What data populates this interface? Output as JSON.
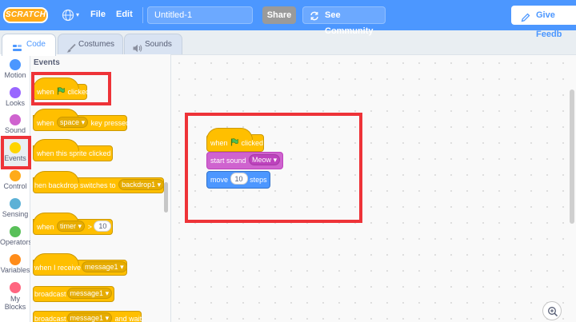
{
  "menubar": {
    "logo_text": "SCRATCH",
    "file": "File",
    "edit": "Edit",
    "project_title": "Untitled-1",
    "share": "Share",
    "see_community": "See Community",
    "give_feedback": "Give Feedb",
    "bg_color": "#4c97ff"
  },
  "tabs": {
    "code": "Code",
    "costumes": "Costumes",
    "sounds": "Sounds"
  },
  "categories": [
    {
      "label": "Motion",
      "color": "#4c97ff"
    },
    {
      "label": "Looks",
      "color": "#9966ff"
    },
    {
      "label": "Sound",
      "color": "#cf63cf"
    },
    {
      "label": "Events",
      "color": "#ffd500"
    },
    {
      "label": "Control",
      "color": "#ffab19"
    },
    {
      "label": "Sensing",
      "color": "#5cb1d6"
    },
    {
      "label": "Operators",
      "color": "#59c059"
    },
    {
      "label": "Variables",
      "color": "#ff8c1a"
    },
    {
      "label": "My Blocks",
      "color": "#ff6680"
    }
  ],
  "palette": {
    "title": "Events",
    "blocks": {
      "flag_when": "when",
      "flag_clicked": "clicked",
      "key_when": "when",
      "key_value": "space",
      "key_suffix": "key pressed",
      "sprite_clicked": "when this sprite clicked",
      "backdrop_prefix": "hen backdrop switches to",
      "backdrop_value": "backdrop1",
      "timer_when": "when",
      "timer_value": "timer",
      "timer_op": ">",
      "timer_num": "10",
      "receive_prefix": "when I receive",
      "receive_value": "message1",
      "broadcast_prefix": "broadcast",
      "broadcast_value": "message1",
      "broadcast_wait_prefix": "broadcast",
      "broadcast_wait_value": "message1",
      "broadcast_wait_suffix": "and wait"
    }
  },
  "script": {
    "when": "when",
    "clicked": "clicked",
    "sound_prefix": "start sound",
    "sound_value": "Meow",
    "move_prefix": "move",
    "move_value": "10",
    "move_suffix": "steps"
  }
}
